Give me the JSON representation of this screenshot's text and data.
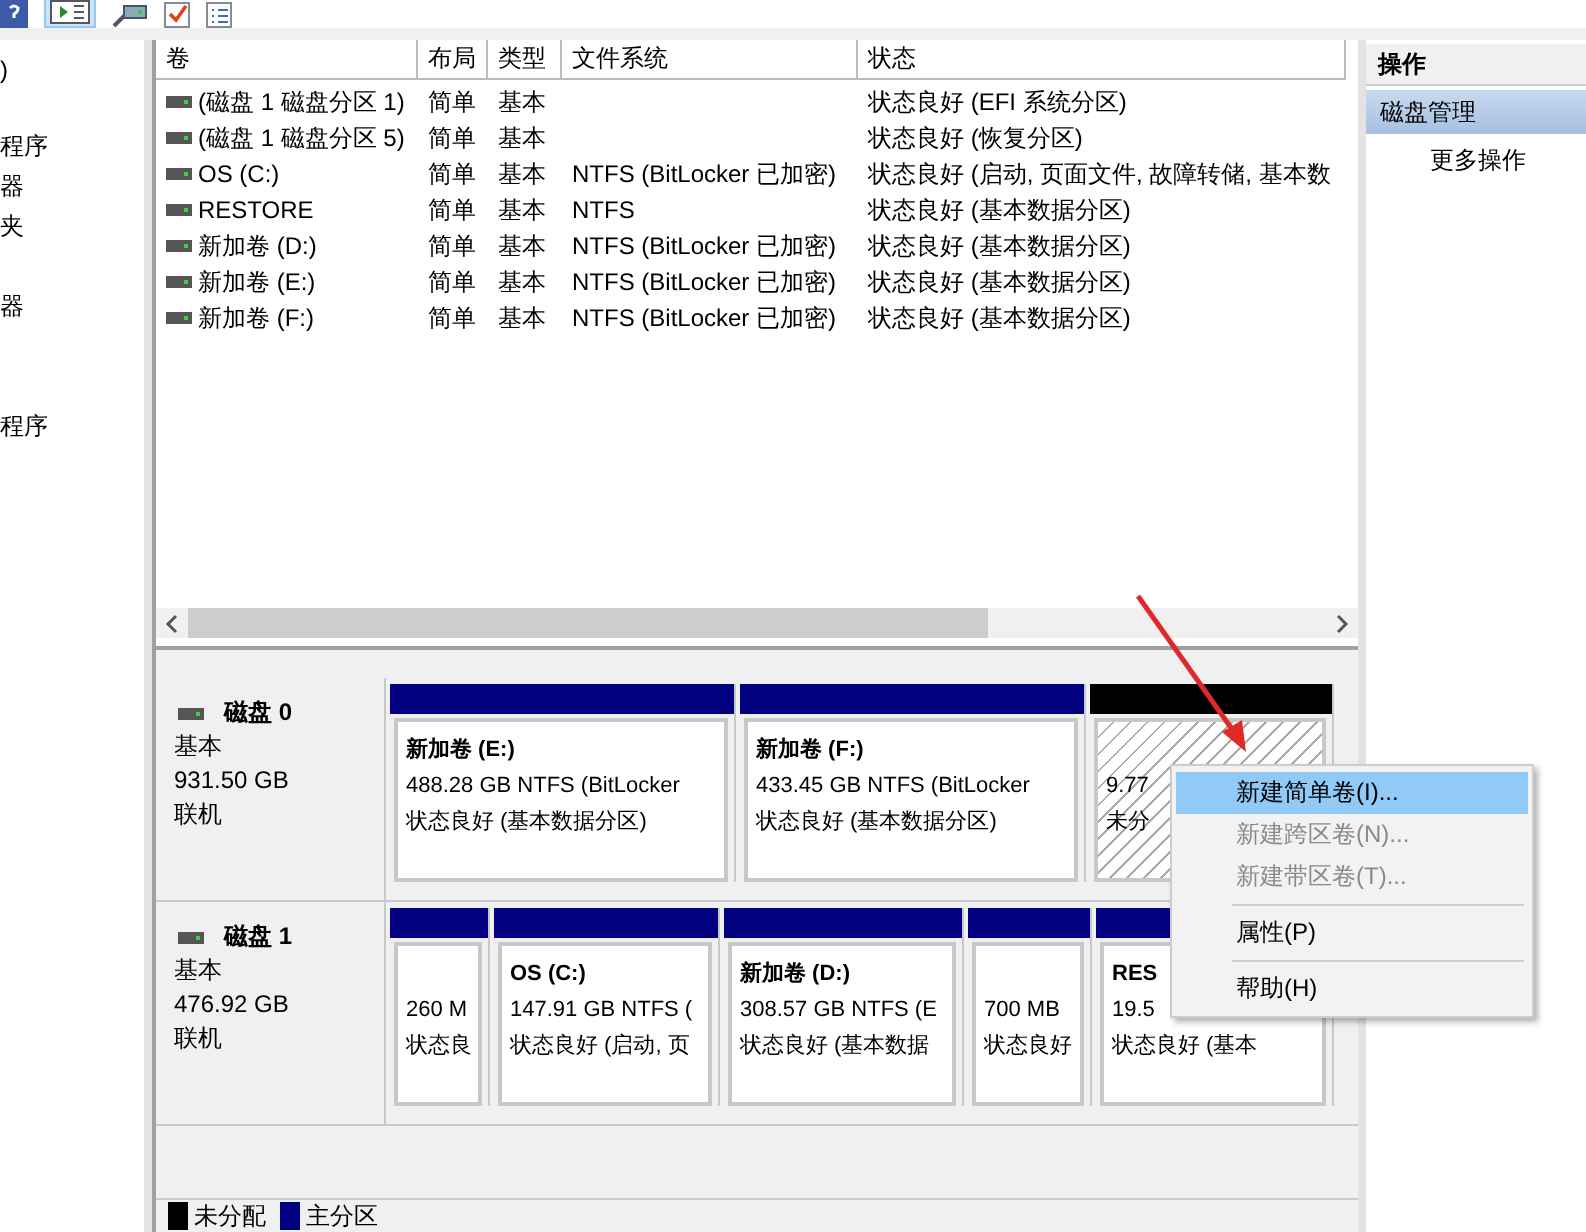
{
  "nav": {
    "items": [
      ")",
      "程序",
      "器",
      "夹",
      "器",
      "程序"
    ]
  },
  "table": {
    "columns": [
      "卷",
      "布局",
      "类型",
      "文件系统",
      "状态"
    ],
    "rows": [
      {
        "cells": [
          "(磁盘 1 磁盘分区 1)",
          "简单",
          "基本",
          "",
          "状态良好 (EFI 系统分区)"
        ]
      },
      {
        "cells": [
          "(磁盘 1 磁盘分区 5)",
          "简单",
          "基本",
          "",
          "状态良好 (恢复分区)"
        ]
      },
      {
        "cells": [
          "OS (C:)",
          "简单",
          "基本",
          "NTFS (BitLocker 已加密)",
          "状态良好 (启动, 页面文件, 故障转储, 基本数"
        ]
      },
      {
        "cells": [
          "RESTORE",
          "简单",
          "基本",
          "NTFS",
          "状态良好 (基本数据分区)"
        ]
      },
      {
        "cells": [
          "新加卷 (D:)",
          "简单",
          "基本",
          "NTFS (BitLocker 已加密)",
          "状态良好 (基本数据分区)"
        ]
      },
      {
        "cells": [
          "新加卷 (E:)",
          "简单",
          "基本",
          "NTFS (BitLocker 已加密)",
          "状态良好 (基本数据分区)"
        ]
      },
      {
        "cells": [
          "新加卷 (F:)",
          "简单",
          "基本",
          "NTFS (BitLocker 已加密)",
          "状态良好 (基本数据分区)"
        ]
      }
    ]
  },
  "disks": [
    {
      "name": "磁盘 0",
      "type": "基本",
      "size": "931.50 GB",
      "status": "联机",
      "partitions": [
        {
          "kind": "primary",
          "color": "#000080",
          "name": "新加卷  (E:)",
          "size": "488.28 GB NTFS (BitLocker",
          "status": "状态良好 (基本数据分区)"
        },
        {
          "kind": "primary",
          "color": "#000080",
          "name": "新加卷  (F:)",
          "size": "433.45 GB NTFS (BitLocker",
          "status": "状态良好 (基本数据分区)"
        },
        {
          "kind": "unallocated",
          "color": "#000000",
          "size": "9.77",
          "status": "未分"
        }
      ]
    },
    {
      "name": "磁盘 1",
      "type": "基本",
      "size": "476.92 GB",
      "status": "联机",
      "partitions": [
        {
          "kind": "primary",
          "color": "#000080",
          "size": "260 M",
          "status": "状态良"
        },
        {
          "kind": "primary",
          "color": "#000080",
          "name": "OS  (C:)",
          "size": "147.91 GB NTFS (",
          "status": "状态良好 (启动, 页"
        },
        {
          "kind": "primary",
          "color": "#000080",
          "name": "新加卷  (D:)",
          "size": "308.57 GB NTFS (E",
          "status": "状态良好 (基本数据"
        },
        {
          "kind": "primary",
          "color": "#000080",
          "size": "700 MB",
          "status": "状态良好"
        },
        {
          "kind": "primary",
          "color": "#000080",
          "name": "RES",
          "size": "19.5",
          "status": "状态良好 (基本"
        }
      ]
    }
  ],
  "legend": [
    {
      "label": "未分配",
      "color": "#000000"
    },
    {
      "label": "主分区",
      "color": "#000080"
    }
  ],
  "actions": {
    "title": "操作",
    "items": [
      {
        "label": "磁盘管理",
        "selected": true
      },
      {
        "label": "更多操作",
        "selected": false
      }
    ]
  },
  "context_menu": {
    "groups": [
      [
        {
          "label": "新建简单卷(I)...",
          "selected": true,
          "disabled": false
        },
        {
          "label": "新建跨区卷(N)...",
          "selected": false,
          "disabled": true
        },
        {
          "label": "新建带区卷(T)...",
          "selected": false,
          "disabled": true
        }
      ],
      [
        {
          "label": "属性(P)",
          "selected": false,
          "disabled": false
        }
      ],
      [
        {
          "label": "帮助(H)",
          "selected": false,
          "disabled": false
        }
      ]
    ]
  }
}
